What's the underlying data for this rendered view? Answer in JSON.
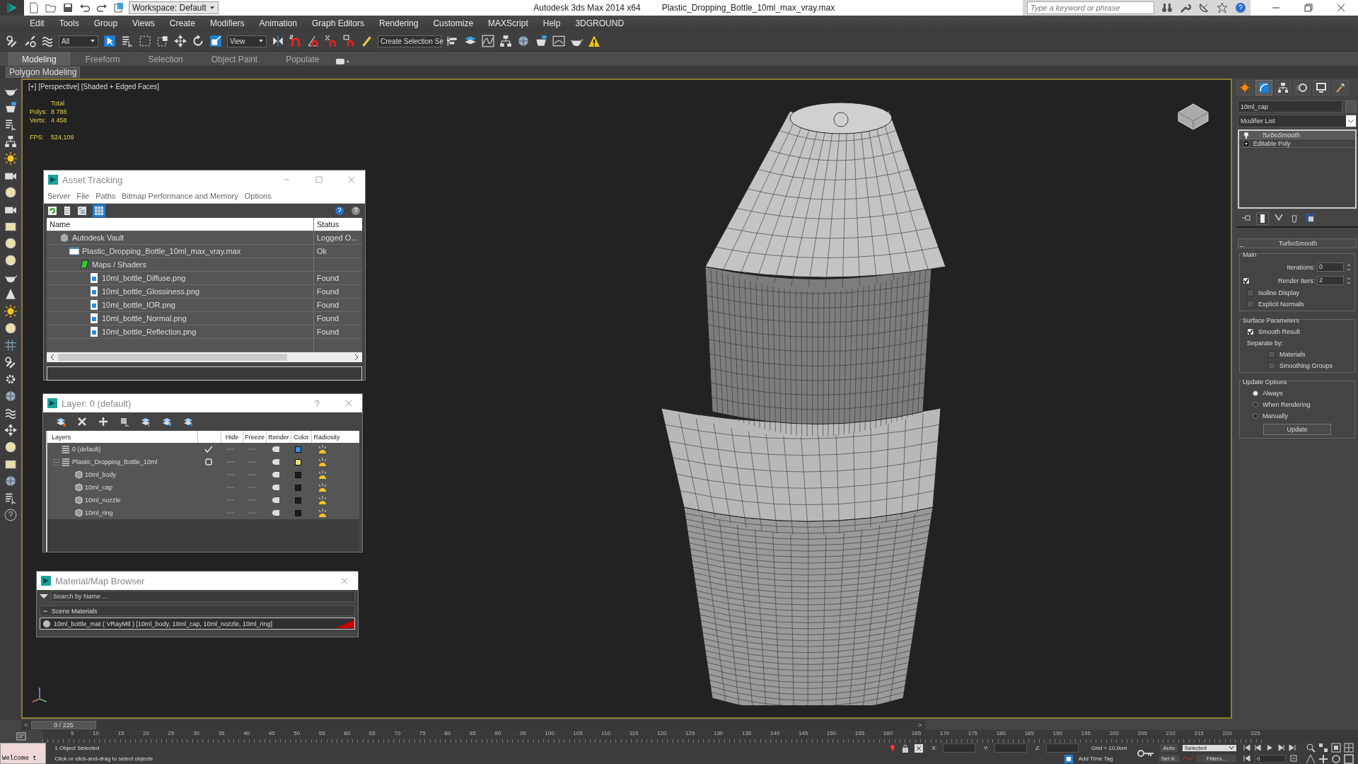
{
  "title_bar": {
    "workspace": "Workspace: Default",
    "app_title": "Autodesk 3ds Max  2014 x64",
    "file_name": "Plastic_Dropping_Bottle_10ml_max_vray.max",
    "search": {
      "placeholder": "Type a keyword or phrase"
    }
  },
  "menu_bar": [
    "Edit",
    "Tools",
    "Group",
    "Views",
    "Create",
    "Modifiers",
    "Animation",
    "Graph Editors",
    "Rendering",
    "Customize",
    "MAXScript",
    "Help",
    "3DGROUND"
  ],
  "main_toolbar": {
    "selection_filter": "All",
    "reference_coordinate": "View",
    "named_selection": "Create Selection Se"
  },
  "ribbon": {
    "tabs": [
      {
        "label": "Modeling",
        "selected": true
      },
      {
        "label": "Freeform",
        "selected": false
      },
      {
        "label": "Selection",
        "selected": false
      },
      {
        "label": "Object Paint",
        "selected": false
      },
      {
        "label": "Populate",
        "selected": false
      }
    ],
    "panel": "Polygon Modeling"
  },
  "viewport": {
    "label": "[+] [Perspective] [Shaded + Edged Faces]",
    "stats": {
      "header": "Total",
      "rows": [
        {
          "label": "Polys:",
          "value": "8 788"
        },
        {
          "label": "Verts:",
          "value": "4 458"
        },
        {
          "label": "FPS:",
          "value": "524,109"
        }
      ]
    }
  },
  "asset_tracking": {
    "title": "Asset Tracking",
    "menu": [
      "Server",
      "File",
      "Paths",
      "Bitmap Performance and Memory",
      "Options"
    ],
    "columns": [
      "Name",
      "Status"
    ],
    "rows": [
      {
        "kind": "vault",
        "name": "Autodesk Vault",
        "status": "Logged O...",
        "children": [
          {
            "kind": "scene",
            "name": "Plastic_Dropping_Bottle_10ml_max_vray.max",
            "status": "Ok",
            "children": [
              {
                "kind": "folder",
                "name": "Maps / Shaders",
                "children": [
                  {
                    "kind": "bitmap",
                    "name": "10ml_bottle_Diffuse.png",
                    "status": "Found"
                  },
                  {
                    "kind": "bitmap",
                    "name": "10ml_bottle_Glossiness.png",
                    "status": "Found"
                  },
                  {
                    "kind": "bitmap",
                    "name": "10ml_bottle_IOR.png",
                    "status": "Found"
                  },
                  {
                    "kind": "bitmap",
                    "name": "10ml_bottle_Normal.png",
                    "status": "Found"
                  },
                  {
                    "kind": "bitmap",
                    "name": "10ml_bottle_Reflection.png",
                    "status": "Found"
                  }
                ]
              }
            ]
          }
        ]
      }
    ]
  },
  "layer_explorer": {
    "title": "Layer: 0 (default)",
    "help": "?",
    "columns": [
      "Layers",
      "Hide",
      "Freeze",
      "Render",
      "Color",
      "Radiosity"
    ],
    "rows": [
      {
        "kind": "layer",
        "name": "0 (default)",
        "current": true,
        "color": "#3a8ee6"
      },
      {
        "kind": "layer",
        "name": "Plastic_Dropping_Bottle_10ml",
        "current": false,
        "expanded": true,
        "color": "#e6e07a",
        "children": [
          {
            "kind": "object",
            "name": "10ml_body",
            "color": "#1c1c1c"
          },
          {
            "kind": "object",
            "name": "10ml_cap",
            "color": "#1c1c1c"
          },
          {
            "kind": "object",
            "name": "10ml_nozzle",
            "color": "#1c1c1c"
          },
          {
            "kind": "object",
            "name": "10ml_ring",
            "color": "#1c1c1c"
          }
        ]
      }
    ]
  },
  "material_browser": {
    "title": "Material/Map Browser",
    "search": {
      "placeholder": "Search by Name ..."
    },
    "groups": [
      {
        "label": "Scene Materials",
        "expanded": true,
        "items": [
          "10ml_bottle_mat ( VRayMtl ) [10ml_body, 10ml_cap, 10ml_nozzle, 10ml_ring]"
        ]
      }
    ]
  },
  "command_panel": {
    "tabs": [
      {
        "selected": false
      },
      {
        "selected": true
      },
      {
        "selected": false
      },
      {
        "selected": false
      },
      {
        "selected": false
      },
      {
        "selected": false
      }
    ],
    "object_name": "10ml_cap",
    "modifier_list": "Modifier List",
    "stack": [
      {
        "label": "TurboSmooth",
        "selected": true
      },
      {
        "label": "Editable Poly",
        "selected": false
      }
    ],
    "rollout": {
      "title": "TurboSmooth",
      "collapse": "_",
      "main": {
        "title": "Main",
        "iterations": {
          "label": "Iterations:",
          "value": "0"
        },
        "render_iters": {
          "label": "Render Iters:",
          "value": "2",
          "checked": true
        },
        "options": [
          {
            "label": "Isoline Display",
            "checked": false
          },
          {
            "label": "Explicit Normals",
            "checked": false
          }
        ]
      },
      "surface": {
        "title": "Surface Parameters",
        "smooth_result": {
          "label": "Smooth Result",
          "checked": true
        },
        "separate_by": "Separate by:",
        "options": [
          {
            "label": "Materials",
            "checked": false
          },
          {
            "label": "Smoothing Groups",
            "checked": false
          }
        ]
      },
      "update": {
        "title": "Update Options",
        "radios": [
          {
            "label": "Always",
            "selected": true
          },
          {
            "label": "When Rendering",
            "selected": false
          },
          {
            "label": "Manually",
            "selected": false
          }
        ],
        "button": "Update"
      }
    }
  },
  "timeline": {
    "frame_slider": "0 / 225",
    "prev": "<",
    "next": ">",
    "ruler_labels": [
      "5",
      "10",
      "15",
      "20",
      "25",
      "30",
      "35",
      "40",
      "45",
      "50",
      "55",
      "60",
      "65",
      "70",
      "75",
      "80",
      "85",
      "90",
      "95",
      "100",
      "105",
      "110",
      "115",
      "120",
      "125",
      "130",
      "135",
      "140",
      "145",
      "150",
      "155",
      "160",
      "165",
      "170",
      "175",
      "180",
      "185",
      "190",
      "195",
      "200",
      "205",
      "210",
      "215",
      "220",
      "225"
    ]
  },
  "status_bar": {
    "listener": "Welcome t",
    "selection": "1 Object Selected",
    "prompt": "Click or click-and-drag to select objects",
    "coords": [
      {
        "label": "X:"
      },
      {
        "label": "Y:"
      },
      {
        "label": "Z:"
      }
    ],
    "grid": "Grid = 10,0cm",
    "add_time_tag": "Add Time Tag",
    "auto_key": "Auto",
    "key_filter": "Selected",
    "set_key": "Set K.",
    "filters": "Filters...",
    "frame": "0"
  }
}
